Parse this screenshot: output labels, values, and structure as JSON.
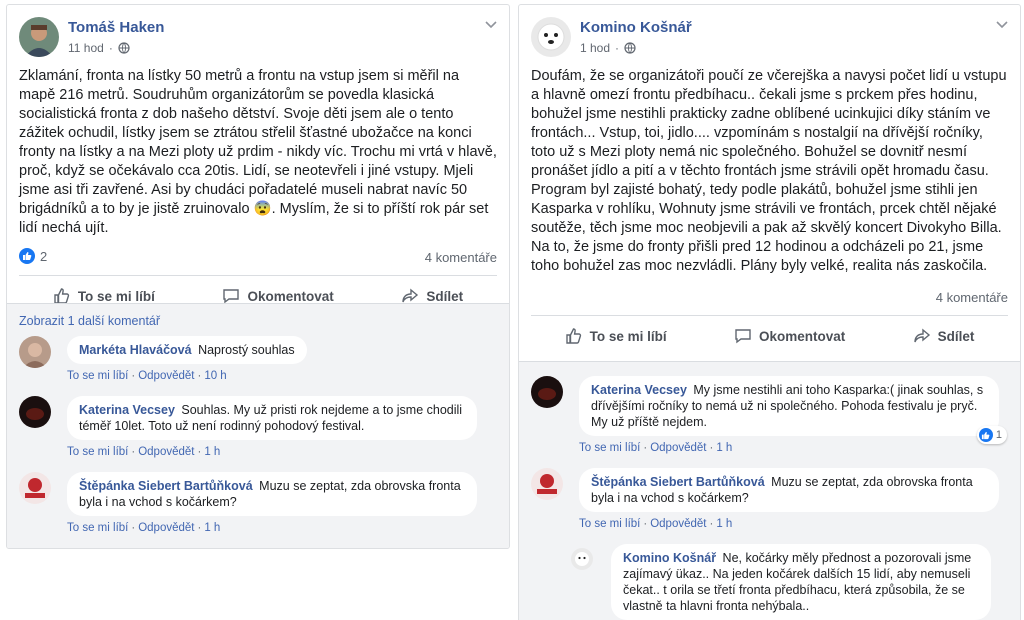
{
  "posts": [
    {
      "author": "Tomáš Haken",
      "time": "11 hod",
      "text": "Zklamání, fronta na lístky 50 metrů a frontu na vstup jsem si měřil na mapě 216 metrů. Soudruhům organizátorům se povedla klasická socialistická fronta z dob našeho dětství. Svoje děti jsem ale o tento zážitek ochudil, lístky jsem se ztrátou střelil šťastné ubožačce na konci fronty na lístky a na Mezi ploty už prdim - nikdy víc. Trochu mi vrtá v hlavě, proč, když se očekávalo cca 20tis. Lidí, se neotevřeli i jiné vstupy. Mjeli jsme asi tři zavřené. Asi by chudáci pořadatelé museli nabrat navíc 50 brigádníků a to by je jistě zruinovalo 😨. Myslím, že si to příští rok pár set lidí nechá ujít.",
      "like_count": "2",
      "comment_count": "4 komentáře",
      "actions": {
        "like": "To se mi líbí",
        "comment": "Okomentovat",
        "share": "Sdílet"
      },
      "more_comments": "Zobrazit 1 další komentář",
      "comments": [
        {
          "author": "Markéta Hlaváčová",
          "text": "Naprostý souhlas",
          "like": "To se mi líbí",
          "reply": "Odpovědět",
          "time": "10 h"
        },
        {
          "author": "Katerina Vecsey",
          "text": "Souhlas. My už pristi rok nejdeme a to jsme chodili téměř 10let. Toto už není rodinný pohodový festival.",
          "like": "To se mi líbí",
          "reply": "Odpovědět",
          "time": "1 h"
        },
        {
          "author": "Štěpánka Siebert Bartůňková",
          "text": "Muzu se zeptat, zda obrovska fronta byla i na vchod s kočárkem?",
          "like": "To se mi líbí",
          "reply": "Odpovědět",
          "time": "1 h"
        }
      ]
    },
    {
      "author": "Komino Košnář",
      "time": "1 hod",
      "text": "Doufám, že se organizátoři poučí ze včerejška a navysi počet lidí u vstupu a hlavně omezí frontu předbíhacu.. čekali jsme s prckem přes hodinu, bohužel jsme nestihli prakticky zadne oblíbené ucinkujici díky stáním ve frontách... Vstup, toi, jidlo.... vzpomínám s nostalgií na dřívější ročníky, toto už s Mezi ploty nemá nic společného. Bohužel se dovnitř nesmí pronášet jídlo a pití a v těchto frontách jsme strávili opět hromadu času. Program byl zajisté bohatý, tedy podle plakátů, bohužel jsme stihli jen Kasparka v rohlíku, Wohnuty jsme strávili ve frontách, prcek chtěl nějaké soutěže, těch jsme moc neobjevili a pak až skvělý koncert Divokyho Billa. Na to, že jsme do fronty přišli pred 12 hodinou a odcházeli po 21, jsme toho bohužel zas moc nezvládli. Plány byly velké, realita nás zaskočila.",
      "comment_count": "4 komentáře",
      "actions": {
        "like": "To se mi líbí",
        "comment": "Okomentovat",
        "share": "Sdílet"
      },
      "comments": [
        {
          "author": "Katerina Vecsey",
          "text": "My jsme nestihli ani toho Kasparka:( jinak souhlas, s dřívějšími ročníky to nemá už ni společného. Pohoda festivalu je pryč. My už příště nejdem.",
          "like": "To se mi líbí",
          "reply": "Odpovědět",
          "time": "1 h",
          "reactions": "1"
        },
        {
          "author": "Štěpánka Siebert Bartůňková",
          "text": "Muzu se zeptat, zda obrovska fronta byla i na vchod s kočárkem?",
          "like": "To se mi líbí",
          "reply": "Odpovědět",
          "time": "1 h"
        }
      ],
      "reply": {
        "author": "Komino Košnář",
        "text": "Ne, kočárky měly přednost a pozorovali jsme zajímavý ükaz.. Na jeden kočárek dalších 15 lidí, aby nemuseli čekat.. t orila se třetí fronta předbíhacu, která způsobila, že se vlastně ta hlavni fronta nehýbala.."
      }
    }
  ],
  "colors": {
    "link": "#385898",
    "action_link": "#4267b2",
    "like_blue": "#1877f2",
    "comment_bg": "#f2f3f5"
  }
}
